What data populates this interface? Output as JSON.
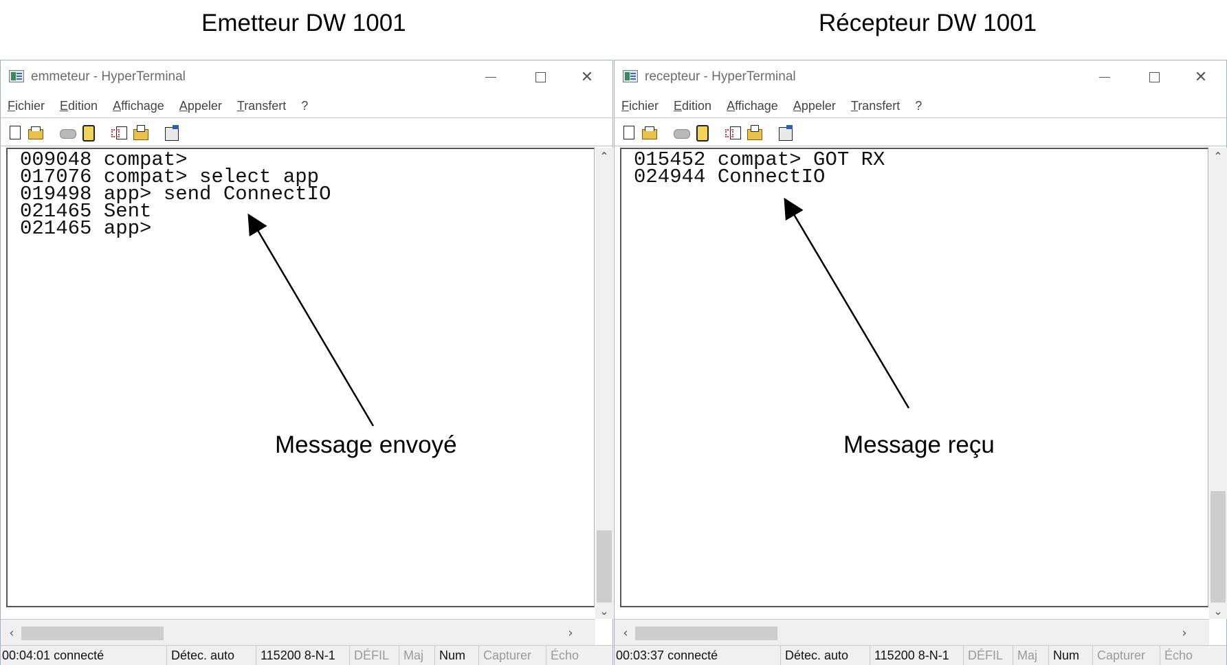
{
  "captions": {
    "left": "Emetteur DW 1001",
    "right": "Récepteur DW 1001"
  },
  "menu": [
    "Fichier",
    "Edition",
    "Affichage",
    "Appeler",
    "Transfert",
    "?"
  ],
  "icons": {
    "app": "hyperterminal-icon",
    "toolbar": [
      "new-icon",
      "open-icon",
      "phone-icon",
      "hangup-icon",
      "send-file-icon",
      "receive-file-icon",
      "properties-icon"
    ]
  },
  "windows": {
    "left": {
      "title": "emmeteur - HyperTerminal",
      "lines": [
        "009048 compat>",
        "017076 compat> select app",
        "019498 app> send ConnectIO",
        "021465 Sent",
        "021465 app>"
      ],
      "status": {
        "connection": "00:04:01 connecté",
        "detect": "Détec. auto",
        "port": "115200 8-N-1",
        "scroll": "DÉFIL",
        "caps": "Maj",
        "num": "Num",
        "capture": "Capturer",
        "echo": "Écho"
      }
    },
    "right": {
      "title": "recepteur - HyperTerminal",
      "lines": [
        "015452 compat> GOT RX",
        "024944 ConnectIO"
      ],
      "status": {
        "connection": "00:03:37 connecté",
        "detect": "Détec. auto",
        "port": "115200 8-N-1",
        "scroll": "DÉFIL",
        "caps": "Maj",
        "num": "Num",
        "capture": "Capturer",
        "echo": "Écho"
      }
    }
  },
  "annotations": {
    "left": "Message envoyé",
    "right": "Message reçu"
  }
}
